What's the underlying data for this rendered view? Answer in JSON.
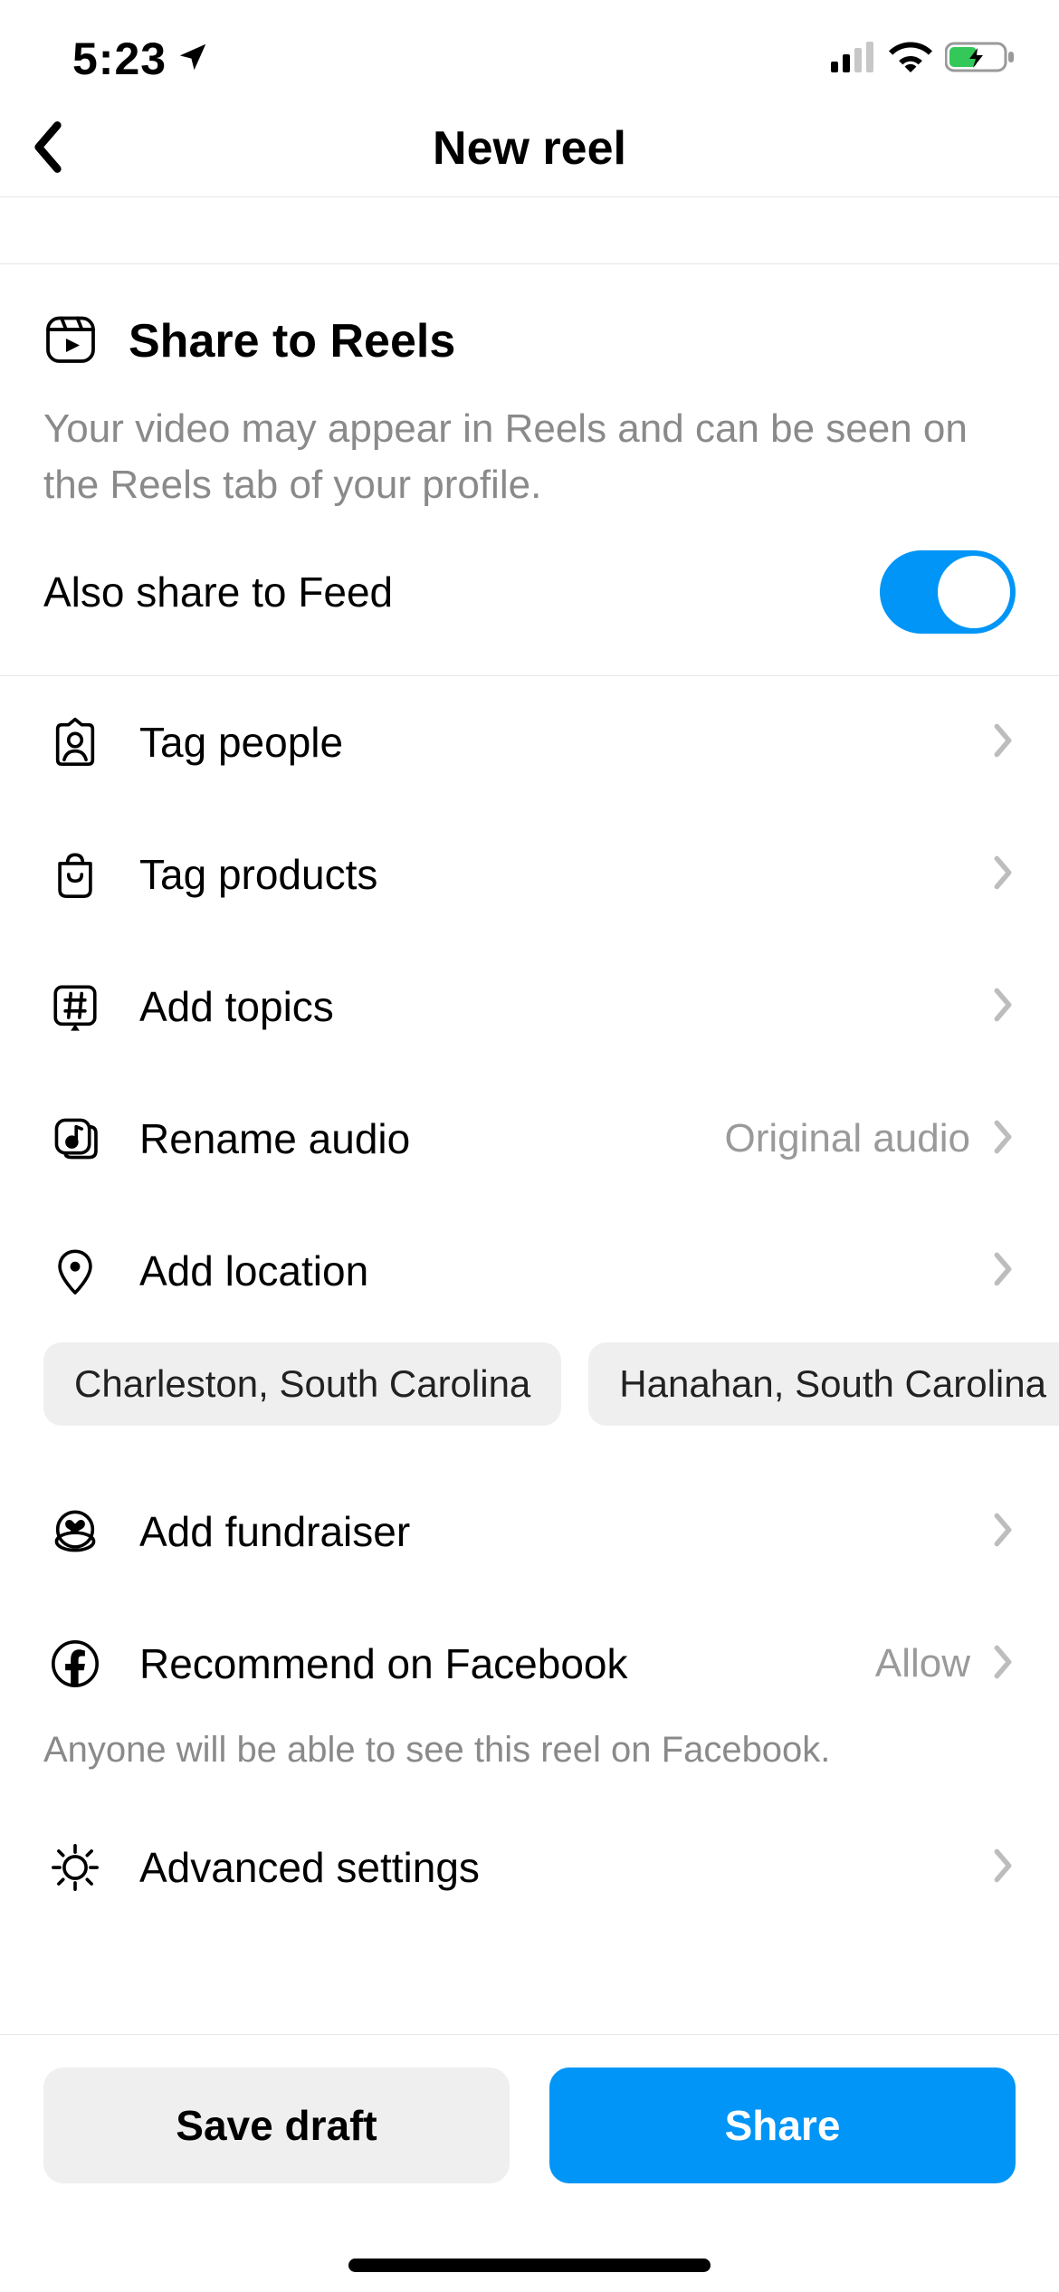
{
  "status": {
    "time": "5:23"
  },
  "nav": {
    "title": "New reel"
  },
  "reels": {
    "title": "Share to Reels",
    "desc": "Your video may appear in Reels and can be seen on the Reels tab of your profile.",
    "feed_label": "Also share to Feed",
    "feed_on": true
  },
  "rows": {
    "tag_people": "Tag people",
    "tag_products": "Tag products",
    "add_topics": "Add topics",
    "rename_audio": "Rename audio",
    "rename_audio_value": "Original audio",
    "add_location": "Add location",
    "add_fundraiser": "Add fundraiser",
    "recommend_fb": "Recommend on Facebook",
    "recommend_fb_value": "Allow",
    "advanced": "Advanced settings"
  },
  "location_suggestions": [
    "Charleston, South Carolina",
    "Hanahan, South Carolina"
  ],
  "fb_desc": "Anyone will be able to see this reel on Facebook.",
  "buttons": {
    "draft": "Save draft",
    "share": "Share"
  }
}
